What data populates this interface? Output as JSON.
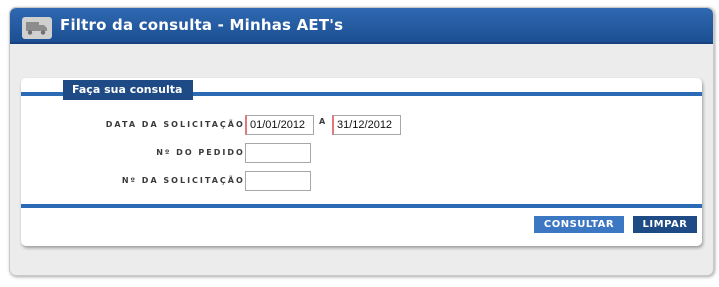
{
  "header": {
    "title": "Filtro da consulta - Minhas AET's",
    "icon": "truck-icon"
  },
  "panel": {
    "title": "Faça sua consulta"
  },
  "form": {
    "data_solicitacao_label": "DATA DA SOLICITAÇÃO:",
    "date_from": "01/01/2012",
    "range_separator": "A",
    "date_to": "31/12/2012",
    "pedido_label": "Nº DO PEDIDO:",
    "pedido_value": "",
    "solicitacao_label": "Nº DA SOLICITAÇÃO:",
    "solicitacao_value": ""
  },
  "actions": {
    "consultar": "CONSULTAR",
    "limpar": "LIMPAR"
  },
  "colors": {
    "header_blue": "#2f69b1",
    "tab_dark_blue": "#1e4a86",
    "button_light_blue": "#3c77c4",
    "required_marker": "#e07a7a"
  }
}
